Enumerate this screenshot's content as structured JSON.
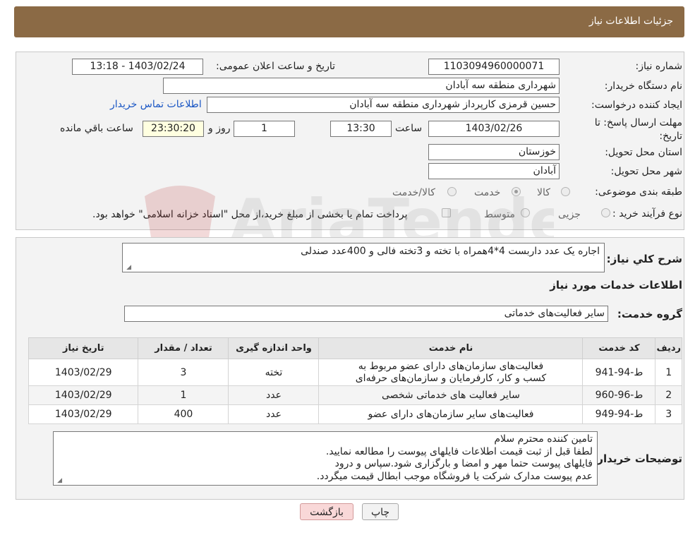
{
  "header": {
    "title": "جزئیات اطلاعات نیاز"
  },
  "info": {
    "need_number_label": "شماره نیاز:",
    "need_number": "1103094960000071",
    "announce_label": "تاریخ و ساعت اعلان عمومی:",
    "announce_value": "1403/02/24 - 13:18",
    "buyer_org_label": "نام دستگاه خریدار:",
    "buyer_org": "شهرداری منطقه سه آبادان",
    "creator_label": "ایجاد کننده درخواست:",
    "creator": "حسین قرمزی کارپرداز شهرداری منطقه سه آبادان",
    "contact_link": "اطلاعات تماس خریدار",
    "deadline_label": "مهلت ارسال پاسخ: تا تاریخ:",
    "deadline_date": "1403/02/26",
    "time_label": "ساعت",
    "deadline_time": "13:30",
    "days_value": "1",
    "days_label": "روز و",
    "remaining_time": "23:30:20",
    "remaining_label": "ساعت باقي مانده",
    "province_label": "استان محل تحویل:",
    "province": "خوزستان",
    "city_label": "شهر محل تحویل:",
    "city": "آبادان",
    "category_label": "طبقه بندی موضوعی:",
    "category_options": [
      {
        "label": "کالا",
        "selected": false
      },
      {
        "label": "خدمت",
        "selected": true
      },
      {
        "label": "کالا/خدمت",
        "selected": false
      }
    ],
    "process_label": "نوع فرآیند خرید :",
    "process_options": [
      {
        "label": "جزیی",
        "selected": false
      },
      {
        "label": "متوسط",
        "selected": false
      }
    ],
    "payment_note": "پرداخت تمام یا بخشی از مبلغ خرید،از محل \"اسناد خزانه اسلامی\" خواهد بود."
  },
  "details": {
    "summary_label": "شرح کلي نیاز:",
    "summary": "اجاره یک عدد داربست 4*4همراه با تخته و 3تخته فالی و 400عدد صندلی",
    "services_title": "اطلاعات خدمات مورد نیاز",
    "service_group_label": "گروه خدمت:",
    "service_group": "سایر فعالیت‌های خدماتی",
    "table": {
      "headers": [
        "ردیف",
        "کد خدمت",
        "نام خدمت",
        "واحد اندازه گیری",
        "تعداد / مقدار",
        "تاریخ نیاز"
      ],
      "rows": [
        {
          "row": "1",
          "code": "ط-94-941",
          "name": "فعالیت‌های سازمان‌های دارای عضو مربوط به کسب و کار، کارفرمایان و سازمان‌های حرفه‌ای",
          "unit": "تخته",
          "qty": "3",
          "date": "1403/02/29"
        },
        {
          "row": "2",
          "code": "ط-96-960",
          "name": "سایر فعالیت های خدماتی شخصی",
          "unit": "عدد",
          "qty": "1",
          "date": "1403/02/29"
        },
        {
          "row": "3",
          "code": "ط-94-949",
          "name": "فعالیت‌های سایر سازمان‌های دارای عضو",
          "unit": "عدد",
          "qty": "400",
          "date": "1403/02/29"
        }
      ]
    },
    "buyer_notes_label": "توضیحات خریدار:",
    "buyer_notes": [
      "تامین کننده محترم سلام",
      "لطفا قبل از ثبت قیمت اطلاعات فایلهای پیوست را مطالعه نمایید.",
      "فایلهای پیوست حتما مهر و امضا و بارگزاری شود.سپاس و درود",
      "عدم پیوست مدارک شرکت یا فروشگاه موجب ابطال قیمت میگردد."
    ]
  },
  "buttons": {
    "print": "چاپ",
    "back": "بازگشت"
  },
  "watermark": {
    "text": "AriaTender.neT"
  },
  "colors": {
    "header_bg": "#8b6a45",
    "link": "#1a56c4",
    "back_button": "#f9d8d8"
  }
}
